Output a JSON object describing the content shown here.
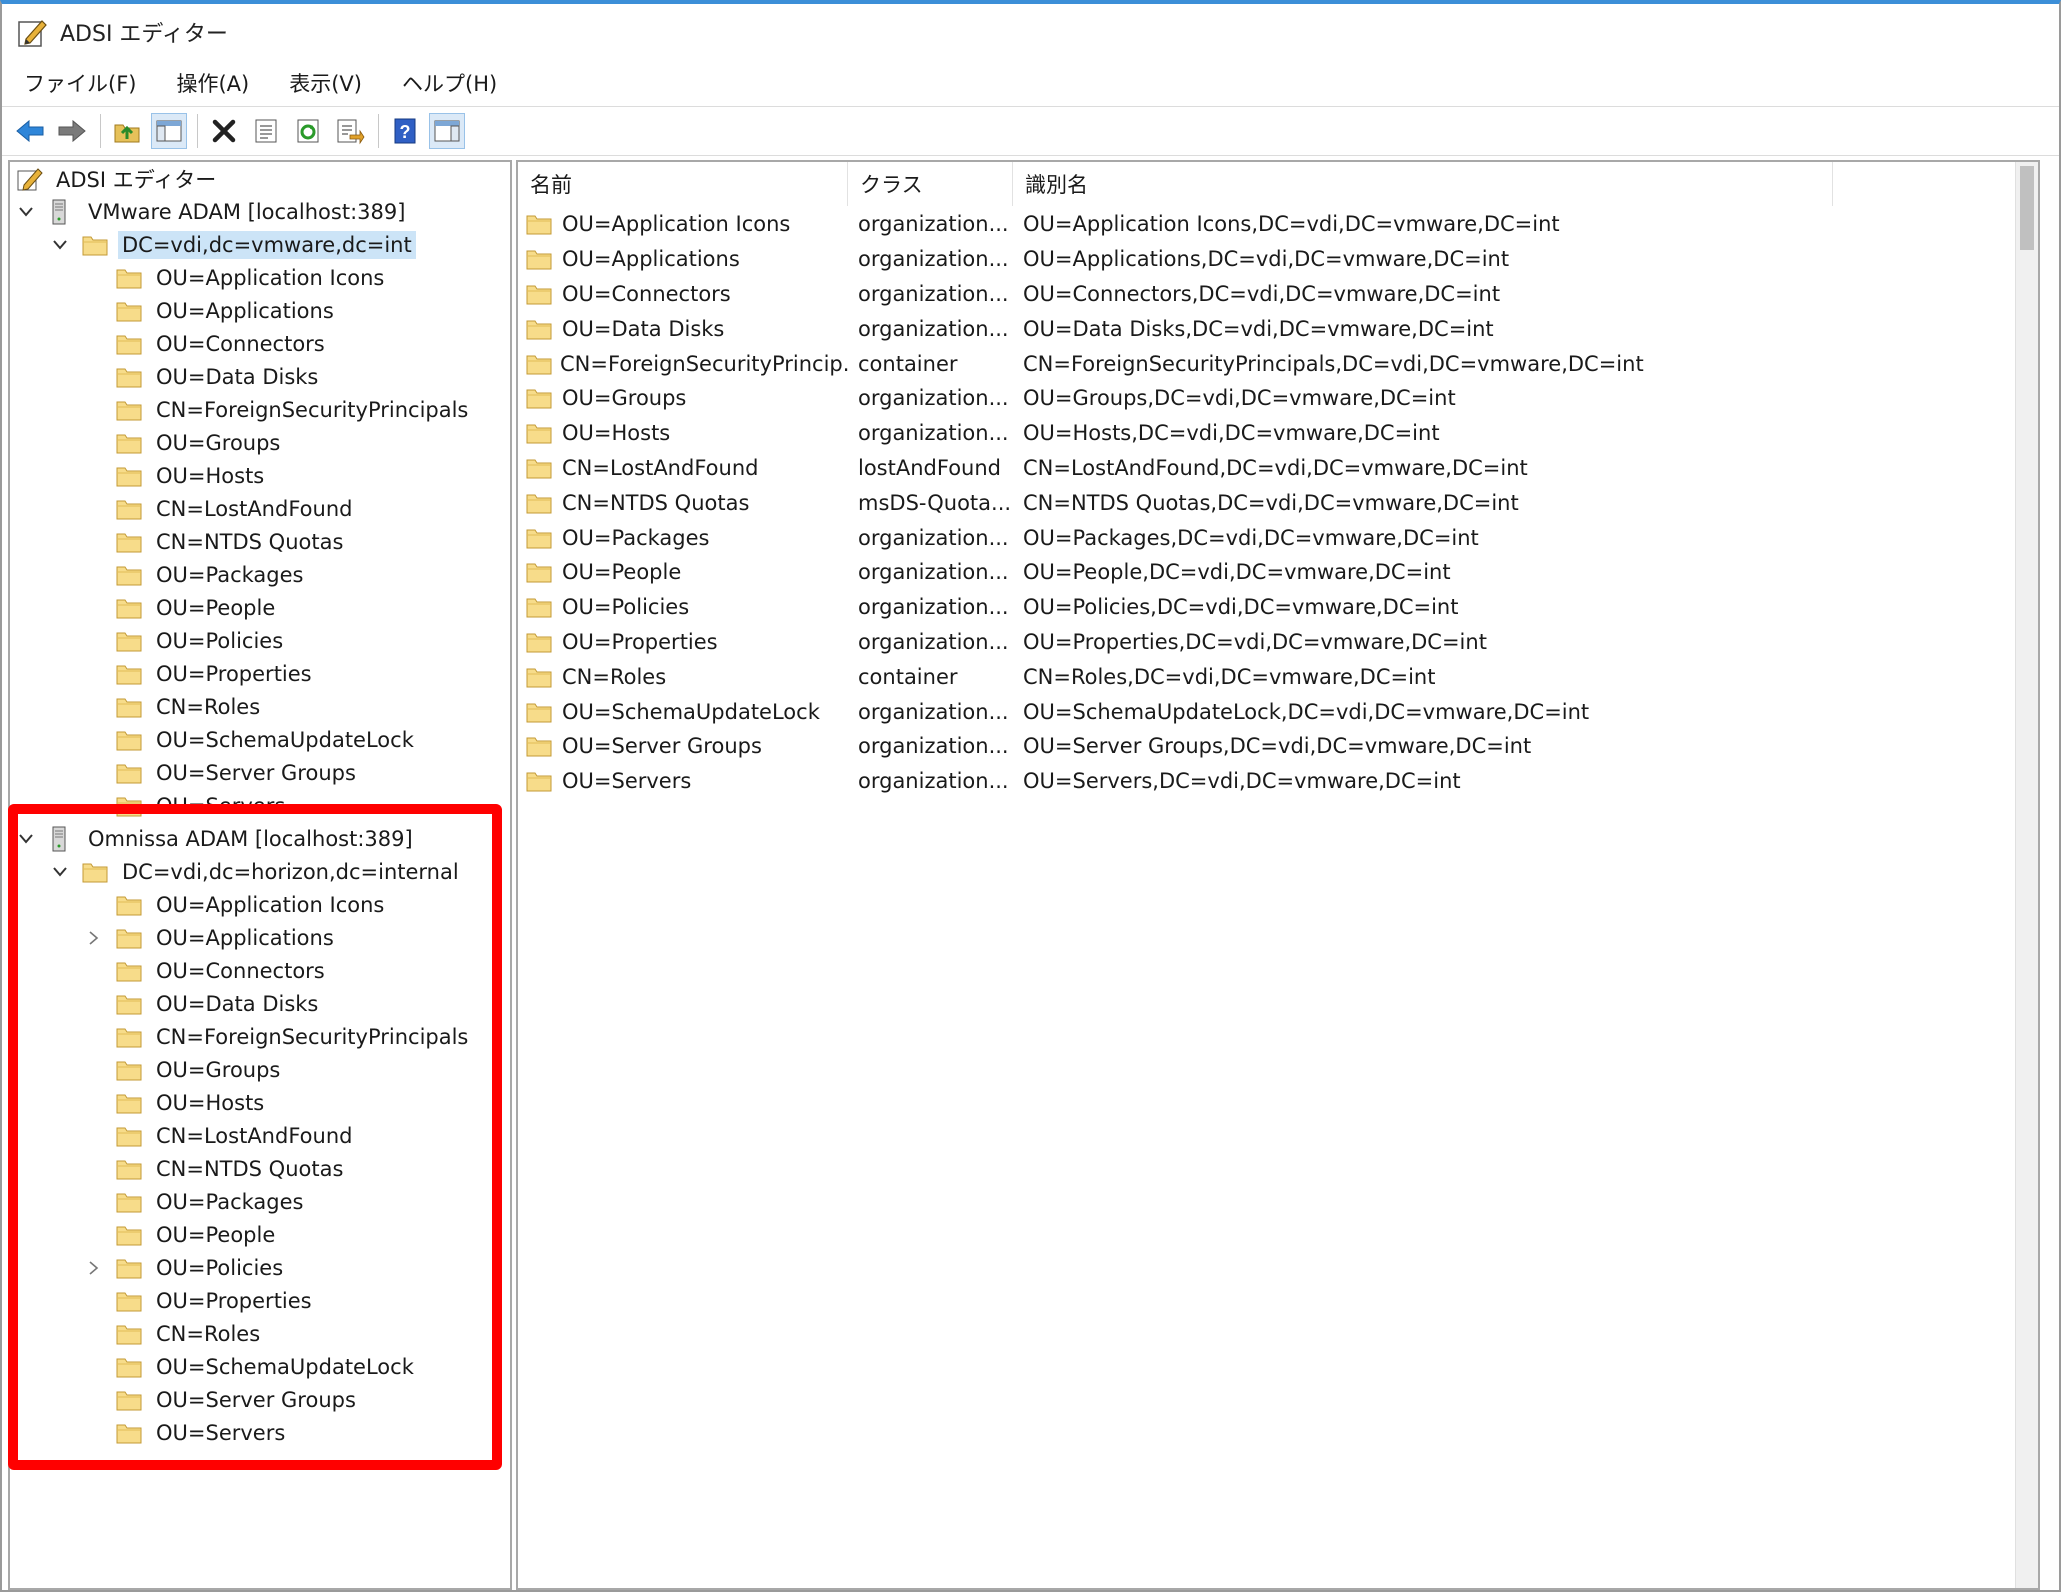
{
  "window": {
    "title": "ADSI エディター"
  },
  "menu": [
    "ファイル(F)",
    "操作(A)",
    "表示(V)",
    "ヘルプ(H)"
  ],
  "toolbar": [
    {
      "name": "back-arrow-icon"
    },
    {
      "name": "forward-arrow-icon"
    },
    {
      "name": "up-folder-icon"
    },
    {
      "name": "show-hide-tree-icon"
    },
    {
      "name": "delete-icon"
    },
    {
      "name": "properties-icon"
    },
    {
      "name": "refresh-icon"
    },
    {
      "name": "export-list-icon"
    },
    {
      "name": "help-icon"
    },
    {
      "name": "show-action-pane-icon"
    }
  ],
  "tree": {
    "root": "ADSI エディター",
    "connections": [
      {
        "name": "VMware ADAM [localhost:389]",
        "domain": "DC=vdi,dc=vmware,dc=int",
        "children": [
          {
            "label": "OU=Application Icons",
            "expandable": false
          },
          {
            "label": "OU=Applications",
            "expandable": false
          },
          {
            "label": "OU=Connectors",
            "expandable": false
          },
          {
            "label": "OU=Data Disks",
            "expandable": false
          },
          {
            "label": "CN=ForeignSecurityPrincipals",
            "expandable": false
          },
          {
            "label": "OU=Groups",
            "expandable": false
          },
          {
            "label": "OU=Hosts",
            "expandable": false
          },
          {
            "label": "CN=LostAndFound",
            "expandable": false
          },
          {
            "label": "CN=NTDS Quotas",
            "expandable": false
          },
          {
            "label": "OU=Packages",
            "expandable": false
          },
          {
            "label": "OU=People",
            "expandable": false
          },
          {
            "label": "OU=Policies",
            "expandable": false
          },
          {
            "label": "OU=Properties",
            "expandable": false
          },
          {
            "label": "CN=Roles",
            "expandable": false
          },
          {
            "label": "OU=SchemaUpdateLock",
            "expandable": false
          },
          {
            "label": "OU=Server Groups",
            "expandable": false
          },
          {
            "label": "OU=Servers",
            "expandable": false
          }
        ]
      },
      {
        "name": "Omnissa ADAM [localhost:389]",
        "domain": "DC=vdi,dc=horizon,dc=internal",
        "children": [
          {
            "label": "OU=Application Icons",
            "expandable": false
          },
          {
            "label": "OU=Applications",
            "expandable": true
          },
          {
            "label": "OU=Connectors",
            "expandable": false
          },
          {
            "label": "OU=Data Disks",
            "expandable": false
          },
          {
            "label": "CN=ForeignSecurityPrincipals",
            "expandable": false
          },
          {
            "label": "OU=Groups",
            "expandable": false
          },
          {
            "label": "OU=Hosts",
            "expandable": false
          },
          {
            "label": "CN=LostAndFound",
            "expandable": false
          },
          {
            "label": "CN=NTDS Quotas",
            "expandable": false
          },
          {
            "label": "OU=Packages",
            "expandable": false
          },
          {
            "label": "OU=People",
            "expandable": false
          },
          {
            "label": "OU=Policies",
            "expandable": true
          },
          {
            "label": "OU=Properties",
            "expandable": false
          },
          {
            "label": "CN=Roles",
            "expandable": false
          },
          {
            "label": "OU=SchemaUpdateLock",
            "expandable": false
          },
          {
            "label": "OU=Server Groups",
            "expandable": false
          },
          {
            "label": "OU=Servers",
            "expandable": false
          }
        ]
      }
    ]
  },
  "list": {
    "columns": [
      "名前",
      "クラス",
      "識別名"
    ],
    "rows": [
      [
        "OU=Application Icons",
        "organization...",
        "OU=Application Icons,DC=vdi,DC=vmware,DC=int"
      ],
      [
        "OU=Applications",
        "organization...",
        "OU=Applications,DC=vdi,DC=vmware,DC=int"
      ],
      [
        "OU=Connectors",
        "organization...",
        "OU=Connectors,DC=vdi,DC=vmware,DC=int"
      ],
      [
        "OU=Data Disks",
        "organization...",
        "OU=Data Disks,DC=vdi,DC=vmware,DC=int"
      ],
      [
        "CN=ForeignSecurityPrincip...",
        "container",
        "CN=ForeignSecurityPrincipals,DC=vdi,DC=vmware,DC=int"
      ],
      [
        "OU=Groups",
        "organization...",
        "OU=Groups,DC=vdi,DC=vmware,DC=int"
      ],
      [
        "OU=Hosts",
        "organization...",
        "OU=Hosts,DC=vdi,DC=vmware,DC=int"
      ],
      [
        "CN=LostAndFound",
        "lostAndFound",
        "CN=LostAndFound,DC=vdi,DC=vmware,DC=int"
      ],
      [
        "CN=NTDS Quotas",
        "msDS-Quota...",
        "CN=NTDS Quotas,DC=vdi,DC=vmware,DC=int"
      ],
      [
        "OU=Packages",
        "organization...",
        "OU=Packages,DC=vdi,DC=vmware,DC=int"
      ],
      [
        "OU=People",
        "organization...",
        "OU=People,DC=vdi,DC=vmware,DC=int"
      ],
      [
        "OU=Policies",
        "organization...",
        "OU=Policies,DC=vdi,DC=vmware,DC=int"
      ],
      [
        "OU=Properties",
        "organization...",
        "OU=Properties,DC=vdi,DC=vmware,DC=int"
      ],
      [
        "CN=Roles",
        "container",
        "CN=Roles,DC=vdi,DC=vmware,DC=int"
      ],
      [
        "OU=SchemaUpdateLock",
        "organization...",
        "OU=SchemaUpdateLock,DC=vdi,DC=vmware,DC=int"
      ],
      [
        "OU=Server Groups",
        "organization...",
        "OU=Server Groups,DC=vdi,DC=vmware,DC=int"
      ],
      [
        "OU=Servers",
        "organization...",
        "OU=Servers,DC=vdi,DC=vmware,DC=int"
      ]
    ]
  },
  "colors": {
    "highlight": "#ff0000",
    "selection": "#cce4f7",
    "folder": "#f5d77a",
    "titlebar_accent": "#3c8fd8"
  }
}
